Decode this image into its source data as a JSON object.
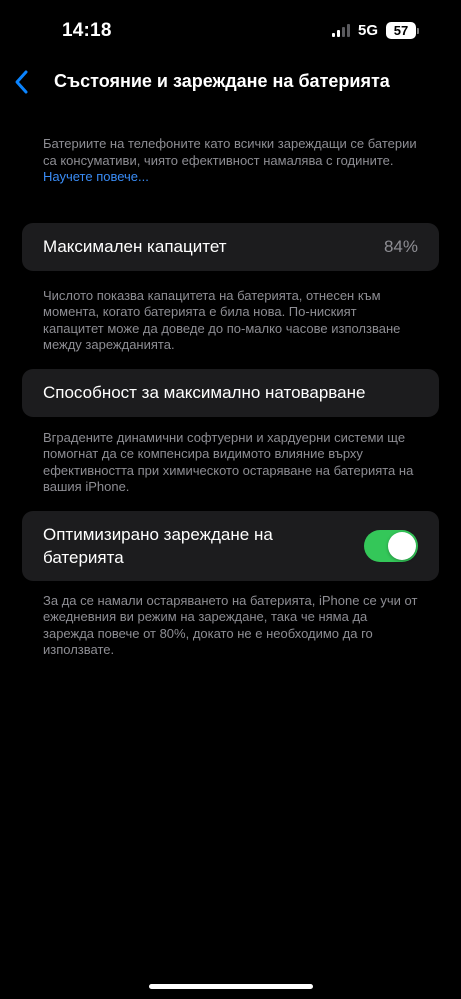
{
  "status_bar": {
    "time": "14:18",
    "network": "5G",
    "battery_level": "57"
  },
  "nav": {
    "back_icon": "chevron-left-icon",
    "title": "Състояние и зареждане на батерията"
  },
  "intro": {
    "text": "Батериите на телефоните като всички зареждащи се батерии са консумативи, чиято ефективност намалява с годините. ",
    "link": "Научете повече..."
  },
  "max_capacity": {
    "label": "Максимален капацитет",
    "value": "84%",
    "footnote": "Числото показва капацитета на батерията, отнесен към момента, когато батерията е била нова. По-ниският капацитет може да доведе до по-малко часове използване между зарежданията."
  },
  "peak_performance": {
    "label": "Способност за максимално натоварване",
    "footnote": "Вградените динамични софтуерни и хардуерни системи ще помогнат да се компенсира видимото влияние върху ефективността при химическото остаряване на батерията на вашия iPhone."
  },
  "optimized_charging": {
    "label": "Оптимизирано зареждане на батерията",
    "enabled": true,
    "footnote": "За да се намали остаряването на батерията, iPhone се учи от ежедневния ви режим на зареждане, така че няма да зарежда повече от 80%, докато не е необходимо да го използвате."
  },
  "colors": {
    "background": "#000000",
    "cell": "#1c1c1e",
    "secondary_text": "#8d8d93",
    "link": "#3a8cf5",
    "accent": "#0a84ff",
    "toggle_on": "#34c759"
  }
}
